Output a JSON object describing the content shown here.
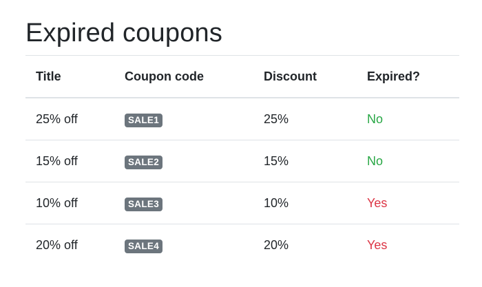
{
  "page": {
    "title": "Expired coupons"
  },
  "table": {
    "headers": [
      "Title",
      "Coupon code",
      "Discount",
      "Expired?"
    ],
    "rows": [
      {
        "title": "25% off",
        "code": "SALE1",
        "discount": "25%",
        "expired": "No"
      },
      {
        "title": "15% off",
        "code": "SALE2",
        "discount": "15%",
        "expired": "No"
      },
      {
        "title": "10% off",
        "code": "SALE3",
        "discount": "10%",
        "expired": "Yes"
      },
      {
        "title": "20% off",
        "code": "SALE4",
        "discount": "20%",
        "expired": "Yes"
      }
    ]
  },
  "colors": {
    "badge_bg": "#6c757d",
    "not_expired": "#28a745",
    "expired": "#dc3545",
    "divider": "#dee2e6"
  }
}
